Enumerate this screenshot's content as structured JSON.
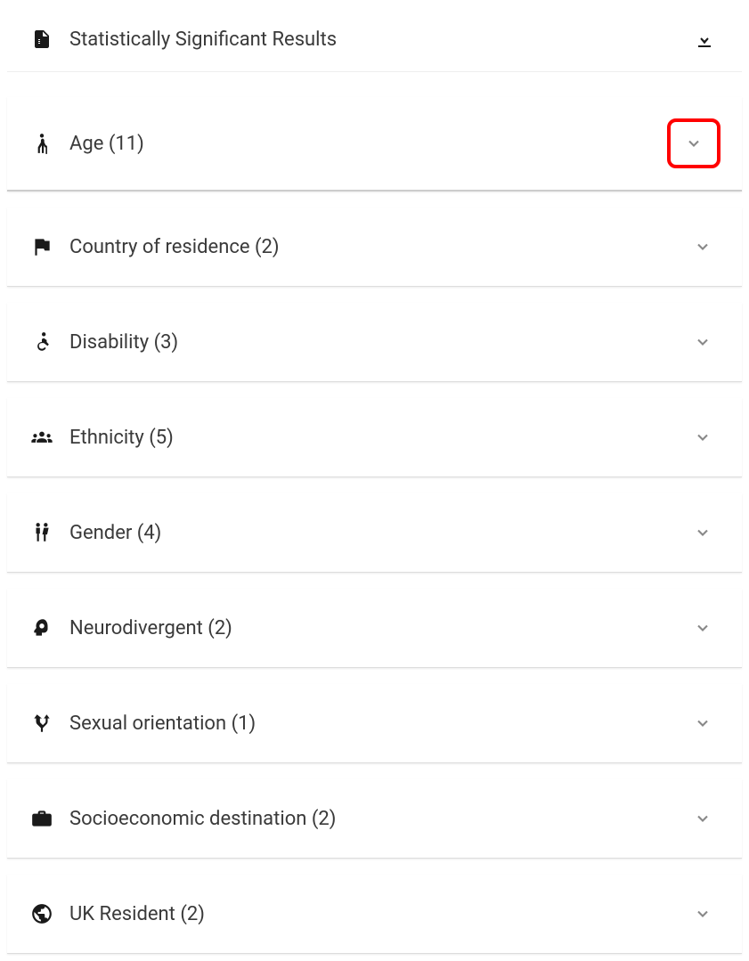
{
  "header": {
    "title": "Statistically Significant Results"
  },
  "categories": [
    {
      "label": "Age (11)",
      "icon": "elderly-icon",
      "highlighted": true
    },
    {
      "label": "Country of residence (2)",
      "icon": "flag-icon",
      "highlighted": false
    },
    {
      "label": "Disability (3)",
      "icon": "accessibility-icon",
      "highlighted": false
    },
    {
      "label": "Ethnicity (5)",
      "icon": "groups-icon",
      "highlighted": false
    },
    {
      "label": "Gender (4)",
      "icon": "gender-icon",
      "highlighted": false
    },
    {
      "label": "Neurodivergent (2)",
      "icon": "psychology-icon",
      "highlighted": false
    },
    {
      "label": "Sexual orientation (1)",
      "icon": "fork-icon",
      "highlighted": false
    },
    {
      "label": "Socioeconomic destination (2)",
      "icon": "briefcase-icon",
      "highlighted": false
    },
    {
      "label": "UK Resident (2)",
      "icon": "globe-icon",
      "highlighted": false
    }
  ]
}
